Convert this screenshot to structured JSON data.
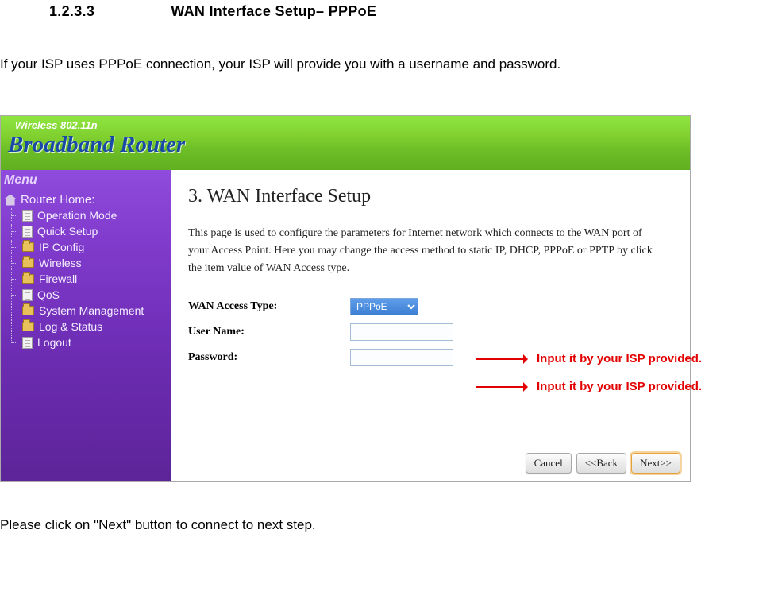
{
  "document": {
    "section_number": "1.2.3.3",
    "section_title": "WAN Interface Setup– PPPoE",
    "intro_text": "If your ISP uses PPPoE connection, your ISP will provide you with a username and password.",
    "outro_text": "Please click on \"Next\" button to connect to next step."
  },
  "router_ui": {
    "banner": {
      "wireless_label": "Wireless 802.11n",
      "title": "Broadband Router"
    },
    "sidebar": {
      "menu_title": "Menu",
      "root_label": "Router Home:",
      "items": [
        {
          "label": "Operation Mode",
          "icon": "doc"
        },
        {
          "label": "Quick Setup",
          "icon": "doc"
        },
        {
          "label": "IP Config",
          "icon": "folder"
        },
        {
          "label": "Wireless",
          "icon": "folder"
        },
        {
          "label": "Firewall",
          "icon": "folder"
        },
        {
          "label": "QoS",
          "icon": "doc"
        },
        {
          "label": "System Management",
          "icon": "folder"
        },
        {
          "label": "Log & Status",
          "icon": "folder"
        },
        {
          "label": "Logout",
          "icon": "doc"
        }
      ]
    },
    "content": {
      "heading": "3. WAN Interface Setup",
      "description": "This page is used to configure the parameters for Internet network which connects to the WAN port of your Access Point. Here you may change the access method to static IP, DHCP, PPPoE or PPTP by click the item value of WAN Access type.",
      "fields": {
        "wan_access_label": "WAN Access Type:",
        "wan_access_selected": "PPPoE",
        "username_label": "User Name:",
        "username_value": "",
        "password_label": "Password:",
        "password_value": ""
      },
      "buttons": {
        "cancel": "Cancel",
        "back": "<<Back",
        "next": "Next>>"
      }
    }
  },
  "annotations": {
    "username_note": "Input it by your ISP provided.",
    "password_note": "Input it by your ISP provided."
  }
}
